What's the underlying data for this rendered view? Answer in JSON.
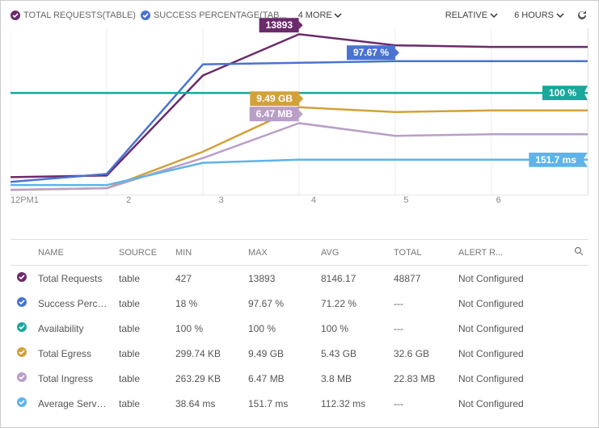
{
  "header": {
    "legend": [
      {
        "label": "TOTAL REQUESTS(TABLE)",
        "color": "#6b2a6b",
        "checked": true
      },
      {
        "label": "SUCCESS PERCENTAGE(TAB...",
        "color": "#4a73d1",
        "checked": true
      }
    ],
    "more_label": "4 MORE",
    "relative_label": "RELATIVE",
    "range_label": "6 HOURS"
  },
  "chart_data": {
    "type": "line",
    "x": [
      "12PM",
      "1",
      "2",
      "3",
      "4",
      "5",
      "6"
    ],
    "series": [
      {
        "name": "Total Requests",
        "color": "#6b2a6b",
        "values_norm": [
          0.1,
          0.11,
          0.74,
          1.0,
          0.93,
          0.92,
          0.92
        ],
        "callout": "13893",
        "callout_at": 3
      },
      {
        "name": "Success Percentage",
        "color": "#4a73d1",
        "values_norm": [
          0.07,
          0.12,
          0.81,
          0.82,
          0.83,
          0.83,
          0.83
        ],
        "callout": "97.67 %",
        "callout_at": 4
      },
      {
        "name": "Availability",
        "color": "#1aa79c",
        "values_norm": [
          0.63,
          0.63,
          0.63,
          0.63,
          0.63,
          0.63,
          0.63
        ],
        "callout": "100 %",
        "callout_at": 6,
        "flag": true
      },
      {
        "name": "Total Egress",
        "color": "#d1a13b",
        "values_norm": [
          0.02,
          0.03,
          0.26,
          0.54,
          0.51,
          0.52,
          0.52
        ],
        "callout": "9.49 GB",
        "callout_at": 3
      },
      {
        "name": "Total Ingress",
        "color": "#b99ec8",
        "values_norm": [
          0.02,
          0.03,
          0.22,
          0.44,
          0.36,
          0.37,
          0.37
        ],
        "callout": "6.47 MB",
        "callout_at": 3
      },
      {
        "name": "Average Server Latency",
        "color": "#5fb3e8",
        "values_norm": [
          0.05,
          0.05,
          0.19,
          0.21,
          0.21,
          0.21,
          0.21
        ],
        "callout": "151.7 ms",
        "callout_at": 6,
        "flag": true
      }
    ]
  },
  "table": {
    "headers": {
      "name": "NAME",
      "source": "SOURCE",
      "min": "MIN",
      "max": "MAX",
      "avg": "AVG",
      "total": "TOTAL",
      "alert": "ALERT R..."
    },
    "rows": [
      {
        "color": "#6b2a6b",
        "name": "Total Requests",
        "source": "table",
        "min": "427",
        "max": "13893",
        "avg": "8146.17",
        "total": "48877",
        "alert": "Not Configured"
      },
      {
        "color": "#4a73d1",
        "name": "Success Perce...",
        "source": "table",
        "min": "18 %",
        "max": "97.67 %",
        "avg": "71.22 %",
        "total": "---",
        "alert": "Not Configured"
      },
      {
        "color": "#1aa79c",
        "name": "Availability",
        "source": "table",
        "min": "100 %",
        "max": "100 %",
        "avg": "100 %",
        "total": "---",
        "alert": "Not Configured"
      },
      {
        "color": "#d1a13b",
        "name": "Total Egress",
        "source": "table",
        "min": "299.74 KB",
        "max": "9.49 GB",
        "avg": "5.43 GB",
        "total": "32.6 GB",
        "alert": "Not Configured"
      },
      {
        "color": "#b99ec8",
        "name": "Total Ingress",
        "source": "table",
        "min": "263.29 KB",
        "max": "6.47 MB",
        "avg": "3.8 MB",
        "total": "22.83 MB",
        "alert": "Not Configured"
      },
      {
        "color": "#5fb3e8",
        "name": "Average Server...",
        "source": "table",
        "min": "38.64 ms",
        "max": "151.7 ms",
        "avg": "112.32 ms",
        "total": "---",
        "alert": "Not Configured"
      }
    ]
  }
}
